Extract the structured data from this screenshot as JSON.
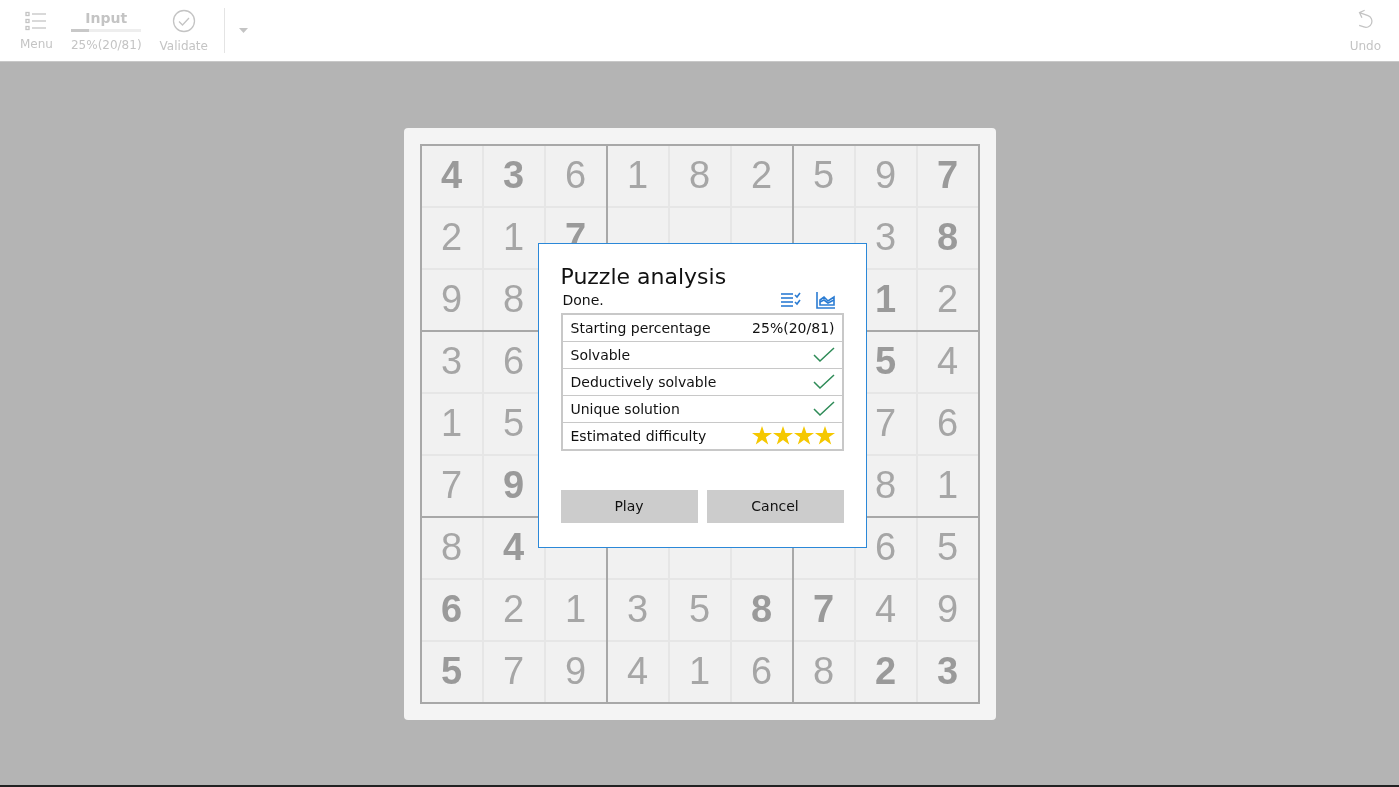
{
  "toolbar": {
    "items": [
      {
        "kind": "menu",
        "label": "Menu",
        "disabled": true
      },
      {
        "kind": "progress",
        "title": "Input",
        "level": 0.25,
        "reading": "25%(20/81)",
        "disabled": true
      },
      {
        "kind": "validate",
        "label": "Validate",
        "disabled": true
      },
      {
        "kind": "dropdown",
        "disabled": true
      }
    ],
    "undo": {
      "label": "Undo",
      "disabled": true
    }
  },
  "board": {
    "rows": [
      [
        {
          "value": "4",
          "given": true
        },
        {
          "value": "3",
          "given": true
        },
        {
          "value": "6",
          "given": false
        },
        {
          "value": "1",
          "given": false
        },
        {
          "value": "8",
          "given": false
        },
        {
          "value": "2",
          "given": false
        },
        {
          "value": "5",
          "given": false
        },
        {
          "value": "9",
          "given": false
        },
        {
          "value": "7",
          "given": true
        }
      ],
      [
        {
          "value": "2",
          "given": false
        },
        {
          "value": "1",
          "given": false
        },
        {
          "value": "7",
          "given": true
        },
        null,
        null,
        null,
        null,
        {
          "value": "3",
          "given": false
        },
        {
          "value": "8",
          "given": true
        }
      ],
      [
        {
          "value": "9",
          "given": false
        },
        {
          "value": "8",
          "given": false
        },
        null,
        null,
        null,
        null,
        null,
        {
          "value": "1",
          "given": true
        },
        {
          "value": "2",
          "given": false
        }
      ],
      [
        {
          "value": "3",
          "given": false
        },
        {
          "value": "6",
          "given": false
        },
        null,
        null,
        null,
        null,
        null,
        {
          "value": "5",
          "given": true
        },
        {
          "value": "4",
          "given": false
        }
      ],
      [
        {
          "value": "1",
          "given": false
        },
        {
          "value": "5",
          "given": false
        },
        null,
        null,
        null,
        null,
        null,
        {
          "value": "7",
          "given": false
        },
        {
          "value": "6",
          "given": false
        }
      ],
      [
        {
          "value": "7",
          "given": false
        },
        {
          "value": "9",
          "given": true
        },
        null,
        null,
        null,
        null,
        null,
        {
          "value": "8",
          "given": false
        },
        {
          "value": "1",
          "given": false
        }
      ],
      [
        {
          "value": "8",
          "given": false
        },
        {
          "value": "4",
          "given": true
        },
        null,
        null,
        null,
        null,
        null,
        {
          "value": "6",
          "given": false
        },
        {
          "value": "5",
          "given": false
        }
      ],
      [
        {
          "value": "6",
          "given": true
        },
        {
          "value": "2",
          "given": false
        },
        {
          "value": "1",
          "given": false
        },
        {
          "value": "3",
          "given": false
        },
        {
          "value": "5",
          "given": false
        },
        {
          "value": "8",
          "given": true
        },
        {
          "value": "7",
          "given": true
        },
        {
          "value": "4",
          "given": false
        },
        {
          "value": "9",
          "given": false
        }
      ],
      [
        {
          "value": "5",
          "given": true
        },
        {
          "value": "7",
          "given": false
        },
        {
          "value": "9",
          "given": false
        },
        {
          "value": "4",
          "given": false
        },
        {
          "value": "1",
          "given": false
        },
        {
          "value": "6",
          "given": false
        },
        {
          "value": "8",
          "given": false
        },
        {
          "value": "2",
          "given": true
        },
        {
          "value": "3",
          "given": true
        }
      ]
    ]
  },
  "dialog": {
    "title": "Puzzle analysis",
    "status": "Done.",
    "rows": [
      {
        "kind": "value",
        "label": "Starting percentage",
        "value": "25%(20/81)"
      },
      {
        "kind": "check",
        "label": "Solvable",
        "checked": true
      },
      {
        "kind": "check",
        "label": "Deductively solvable",
        "checked": true
      },
      {
        "kind": "check",
        "label": "Unique solution",
        "checked": true
      },
      {
        "kind": "stars",
        "label": "Estimated difficulty",
        "stars": 4
      }
    ],
    "buttons": [
      "Play",
      "Cancel"
    ]
  }
}
